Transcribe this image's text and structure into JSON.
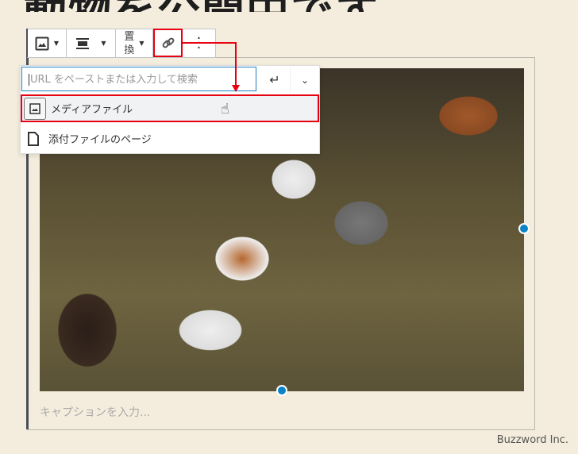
{
  "toolbar": {
    "replace_label_1": "置",
    "replace_label_2": "換"
  },
  "link_popover": {
    "url_placeholder": "URL をペーストまたは入力して検索",
    "items": [
      {
        "label": "メディアファイル",
        "icon": "image-icon"
      },
      {
        "label": "添付ファイルのページ",
        "icon": "page-icon"
      }
    ]
  },
  "caption_placeholder": "キャプションを入力...",
  "credit": "Buzzword Inc.",
  "colors": {
    "highlight": "#e60012",
    "accent": "#0a84c6",
    "background": "#f4eddd"
  }
}
